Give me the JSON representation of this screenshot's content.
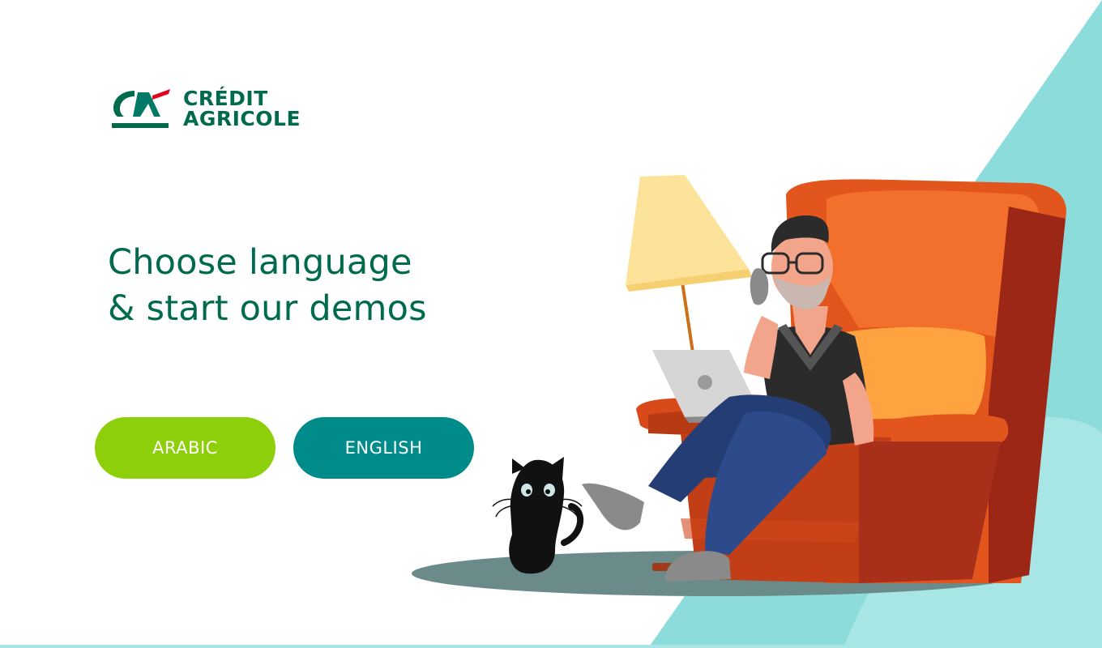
{
  "brand": {
    "name_line1": "CRÉDIT",
    "name_line2": "AGRICOLE",
    "logo_icon": "credit-agricole-logo-icon"
  },
  "headline": {
    "line1": "Choose language",
    "line2": "& start our demos"
  },
  "buttons": {
    "arabic_label": "ARABIC",
    "english_label": "ENGLISH"
  },
  "illustration": {
    "icon": "man-on-armchair-with-laptop-and-cat-illustration"
  },
  "colors": {
    "brand_green": "#006a4d",
    "brand_red": "#e2001a",
    "arabic_button": "#8dcf0a",
    "english_button": "#008b8b",
    "background_teal": "#8ddcdc",
    "headline_text": "#006a4d"
  }
}
